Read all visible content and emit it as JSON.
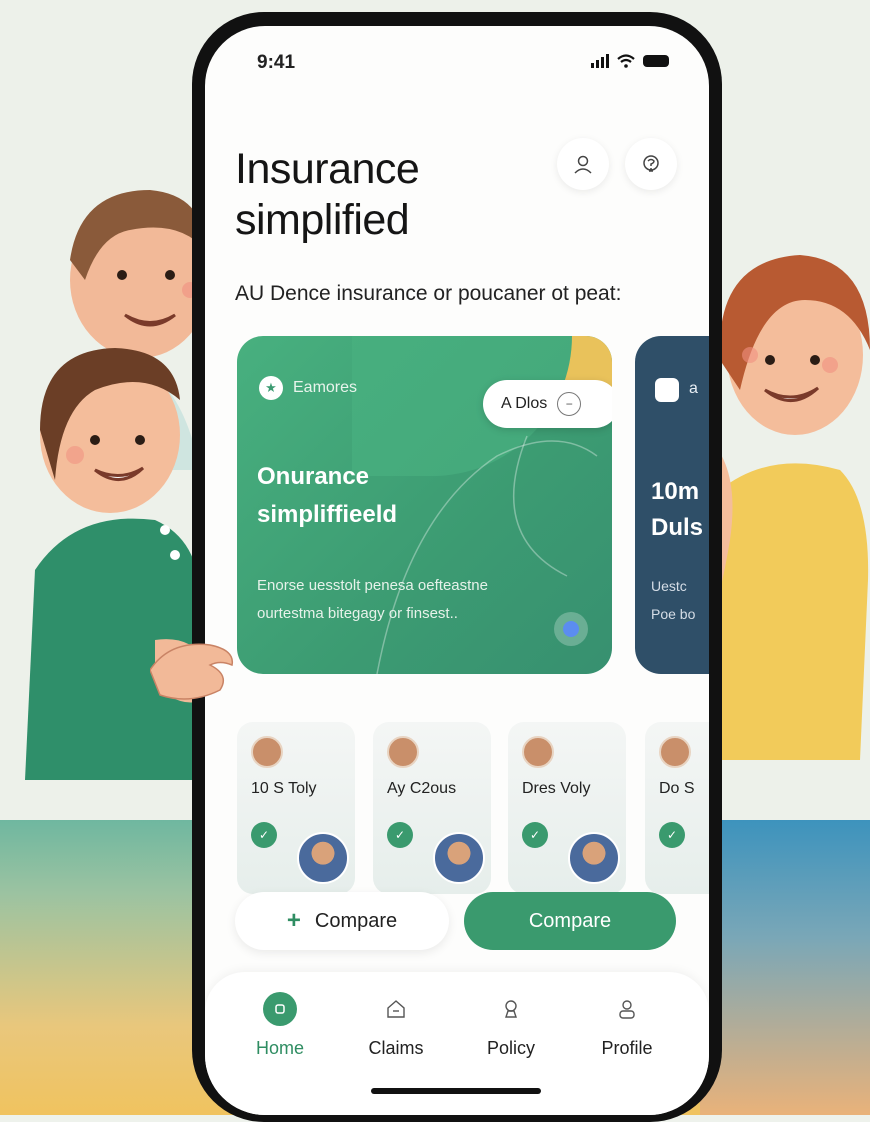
{
  "status_bar": {
    "time": "9:41"
  },
  "header": {
    "title_line1": "Insurance",
    "title_line2": "simplified",
    "profile_icon": "user-icon",
    "support_icon": "help-icon"
  },
  "subtitle": "AU Dence insurance or poucaner ot peat:",
  "featured_card": {
    "tag": "Eamores",
    "pill_label": "A Dlos",
    "heading_line1": "Onurance",
    "heading_line2": "simpliffieeld",
    "desc_line1": "Enorse uesstolt penesa oefteastne",
    "desc_line2": "ourtestma bitegagy or finsest..",
    "accent": "#3c9b72",
    "corner_color": "#e9c25b"
  },
  "secondary_card": {
    "tag": "a",
    "heading_line1": "10m",
    "heading_line2": "Duls",
    "desc_line1": "Uestc",
    "desc_line2": "Poe bo",
    "color": "#2f4f68"
  },
  "plans": [
    {
      "label": "10 S Toly"
    },
    {
      "label": "Ay C2ous"
    },
    {
      "label": "Dres Voly"
    },
    {
      "label": "Do S"
    }
  ],
  "actions": {
    "compare_outline": "Compare",
    "compare_solid": "Compare",
    "primary_color": "#3a9a6e"
  },
  "nav": {
    "items": [
      {
        "label": "Home",
        "icon": "home-icon",
        "active": true
      },
      {
        "label": "Claims",
        "icon": "claims-icon",
        "active": false
      },
      {
        "label": "Policy",
        "icon": "policy-icon",
        "active": false
      },
      {
        "label": "Profile",
        "icon": "profile-icon",
        "active": false
      }
    ]
  }
}
